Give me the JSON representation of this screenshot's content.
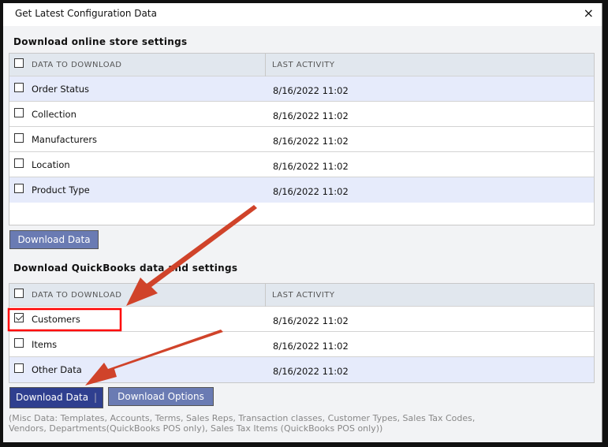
{
  "dialog": {
    "title": "Get Latest Configuration Data",
    "close_icon": "×"
  },
  "online": {
    "heading": "Download online store settings",
    "col1": "DATA TO DOWNLOAD",
    "col2": "LAST ACTIVITY",
    "rows": [
      {
        "name": "Order Status",
        "date": "8/16/2022 11:02",
        "checked": false
      },
      {
        "name": "Collection",
        "date": "8/16/2022 11:02",
        "checked": false
      },
      {
        "name": "Manufacturers",
        "date": "8/16/2022 11:02",
        "checked": false
      },
      {
        "name": "Location",
        "date": "8/16/2022 11:02",
        "checked": false
      },
      {
        "name": "Product Type",
        "date": "8/16/2022 11:02",
        "checked": false
      }
    ],
    "button": "Download Data"
  },
  "qb": {
    "heading": "Download QuickBooks data and settings",
    "col1": "DATA TO DOWNLOAD",
    "col2": "LAST ACTIVITY",
    "rows": [
      {
        "name": "Customers",
        "date": "8/16/2022 11:02",
        "checked": true
      },
      {
        "name": "Items",
        "date": "8/16/2022 11:02",
        "checked": false
      },
      {
        "name": "Other Data",
        "date": "8/16/2022 11:02",
        "checked": false
      }
    ],
    "button": "Download Data",
    "options_button": "Download Options"
  },
  "note": "(Misc Data: Templates, Accounts, Terms, Sales Reps, Transaction classes, Customer Types, Sales Tax Codes, Vendors, Departments(QuickBooks POS only), Sales Tax Items (QuickBooks POS only))",
  "colors": {
    "primary_button": "#2f3f8f",
    "secondary_button": "#6a7bb3",
    "annotation": "#d0432a",
    "highlight": "#ff0000"
  }
}
